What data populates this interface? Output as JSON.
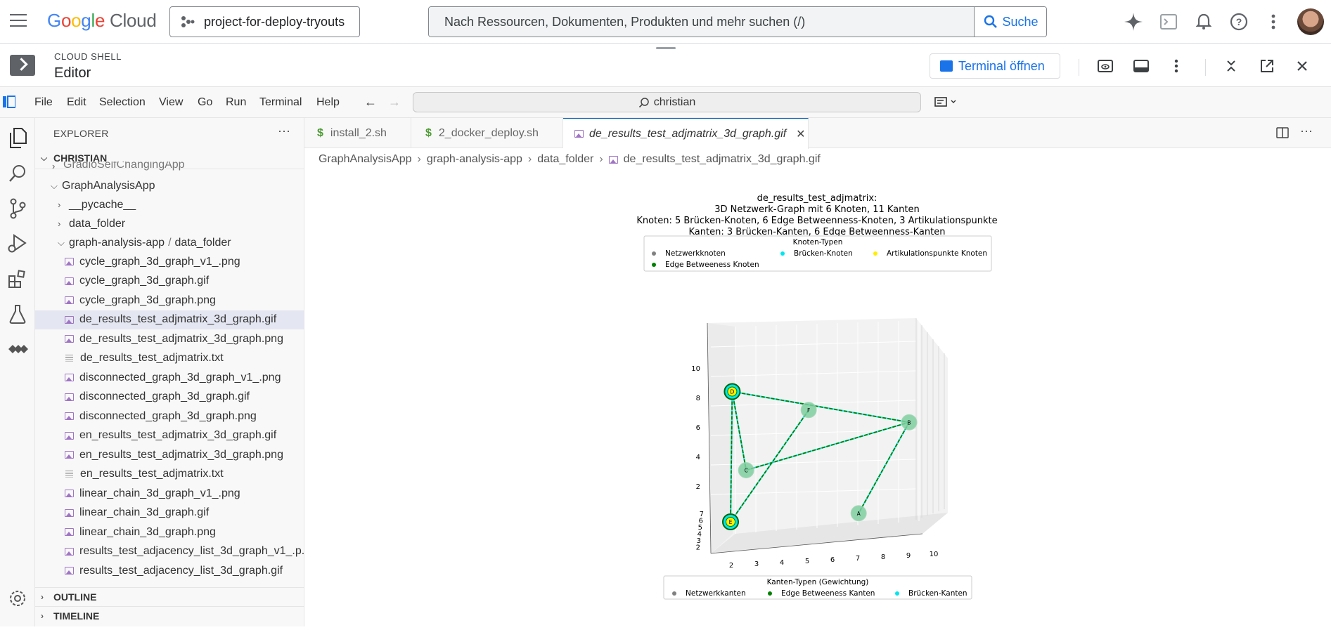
{
  "topbar": {
    "logo_google": "Google",
    "logo_cloud": "Cloud",
    "project": "project-for-deploy-tryouts",
    "search_placeholder": "Nach Ressourcen, Dokumenten, Produkten und mehr suchen (/)",
    "search_button": "Suche"
  },
  "shell": {
    "subtitle": "CLOUD SHELL",
    "title": "Editor",
    "open_terminal": "Terminal öffnen"
  },
  "menubar": {
    "items": [
      "File",
      "Edit",
      "Selection",
      "View",
      "Go",
      "Run",
      "Terminal",
      "Help"
    ],
    "command_center": "christian"
  },
  "sidebar": {
    "title": "EXPLORER",
    "root": "CHRISTIAN",
    "partial_item": "GradioSelfChangingApp",
    "folders": {
      "app": "GraphAnalysisApp",
      "pycache": "__pycache__",
      "data_folder": "data_folder",
      "compact_a": "graph-analysis-app",
      "compact_sep": "/",
      "compact_b": "data_folder"
    },
    "files": [
      {
        "name": "cycle_graph_3d_graph_v1_.png",
        "type": "image"
      },
      {
        "name": "cycle_graph_3d_graph.gif",
        "type": "image"
      },
      {
        "name": "cycle_graph_3d_graph.png",
        "type": "image"
      },
      {
        "name": "de_results_test_adjmatrix_3d_graph.gif",
        "type": "image",
        "selected": true
      },
      {
        "name": "de_results_test_adjmatrix_3d_graph.png",
        "type": "image"
      },
      {
        "name": "de_results_test_adjmatrix.txt",
        "type": "text"
      },
      {
        "name": "disconnected_graph_3d_graph_v1_.png",
        "type": "image"
      },
      {
        "name": "disconnected_graph_3d_graph.gif",
        "type": "image"
      },
      {
        "name": "disconnected_graph_3d_graph.png",
        "type": "image"
      },
      {
        "name": "en_results_test_adjmatrix_3d_graph.gif",
        "type": "image"
      },
      {
        "name": "en_results_test_adjmatrix_3d_graph.png",
        "type": "image"
      },
      {
        "name": "en_results_test_adjmatrix.txt",
        "type": "text"
      },
      {
        "name": "linear_chain_3d_graph_v1_.png",
        "type": "image"
      },
      {
        "name": "linear_chain_3d_graph.gif",
        "type": "image"
      },
      {
        "name": "linear_chain_3d_graph.png",
        "type": "image"
      },
      {
        "name": "results_test_adjacency_list_3d_graph_v1_.p...",
        "type": "image"
      },
      {
        "name": "results_test_adjacency_list_3d_graph.gif",
        "type": "image"
      }
    ],
    "outline": "OUTLINE",
    "timeline": "TIMELINE"
  },
  "tabs": [
    {
      "label": "install_2.sh",
      "icon": "$"
    },
    {
      "label": "2_docker_deploy.sh",
      "icon": "$"
    },
    {
      "label": "de_results_test_adjmatrix_3d_graph.gif",
      "active": true
    }
  ],
  "breadcrumb": [
    "GraphAnalysisApp",
    "graph-analysis-app",
    "data_folder",
    "de_results_test_adjmatrix_3d_graph.gif"
  ],
  "chart_data": {
    "type": "scatter",
    "projection": "3d",
    "title_lines": [
      "de_results_test_adjmatrix:",
      "3D Netzwerk-Graph mit 6 Knoten, 11 Kanten",
      "Knoten: 5 Brücken-Knoten, 6 Edge Betweenness-Knoten, 3 Artikulationspunkte",
      "Kanten: 3 Brücken-Kanten, 6 Edge Betweenness-Kanten"
    ],
    "node_legend": {
      "title": "Knoten-Typen",
      "entries": [
        {
          "label": "Netzwerkknoten",
          "color": "#808080"
        },
        {
          "label": "Brücken-Knoten",
          "color": "#00e5ee"
        },
        {
          "label": "Artikulationspunkte Knoten",
          "color": "#ffee00"
        },
        {
          "label": "Edge Betweeness Knoten",
          "color": "#008000"
        }
      ]
    },
    "edge_legend": {
      "title": "Kanten-Typen (Gewichtung)",
      "entries": [
        {
          "label": "Netzwerkkanten",
          "color": "#808080"
        },
        {
          "label": "Edge Betweeness Kanten",
          "color": "#008000"
        },
        {
          "label": "Brücken-Kanten",
          "color": "#00e5ee"
        }
      ]
    },
    "axes": {
      "x_ticks": [
        "2",
        "3",
        "4",
        "5",
        "6",
        "7",
        "8",
        "9",
        "10"
      ],
      "y_ticks": [
        "2",
        "3",
        "4",
        "5",
        "6",
        "7"
      ],
      "z_ticks": [
        "2",
        "4",
        "6",
        "8",
        "10"
      ]
    },
    "nodes": [
      {
        "label": "D",
        "x": 2.1,
        "y": 6.5,
        "z": 10,
        "articulation": true
      },
      {
        "label": "F",
        "x": 5.3,
        "y": 6.5,
        "z": 8.5
      },
      {
        "label": "B",
        "x": 9.5,
        "y": 6.5,
        "z": 7.5
      },
      {
        "label": "C",
        "x": 2.8,
        "y": 5.5,
        "z": 4
      },
      {
        "label": "A",
        "x": 7.8,
        "y": 3,
        "z": 1.5
      },
      {
        "label": "E",
        "x": 2.5,
        "y": 2.5,
        "z": 1,
        "articulation": true
      }
    ],
    "edges": [
      {
        "from": "D",
        "to": "B"
      },
      {
        "from": "D",
        "to": "C"
      },
      {
        "from": "D",
        "to": "E"
      },
      {
        "from": "C",
        "to": "B"
      },
      {
        "from": "F",
        "to": "E"
      },
      {
        "from": "B",
        "to": "A"
      }
    ]
  }
}
